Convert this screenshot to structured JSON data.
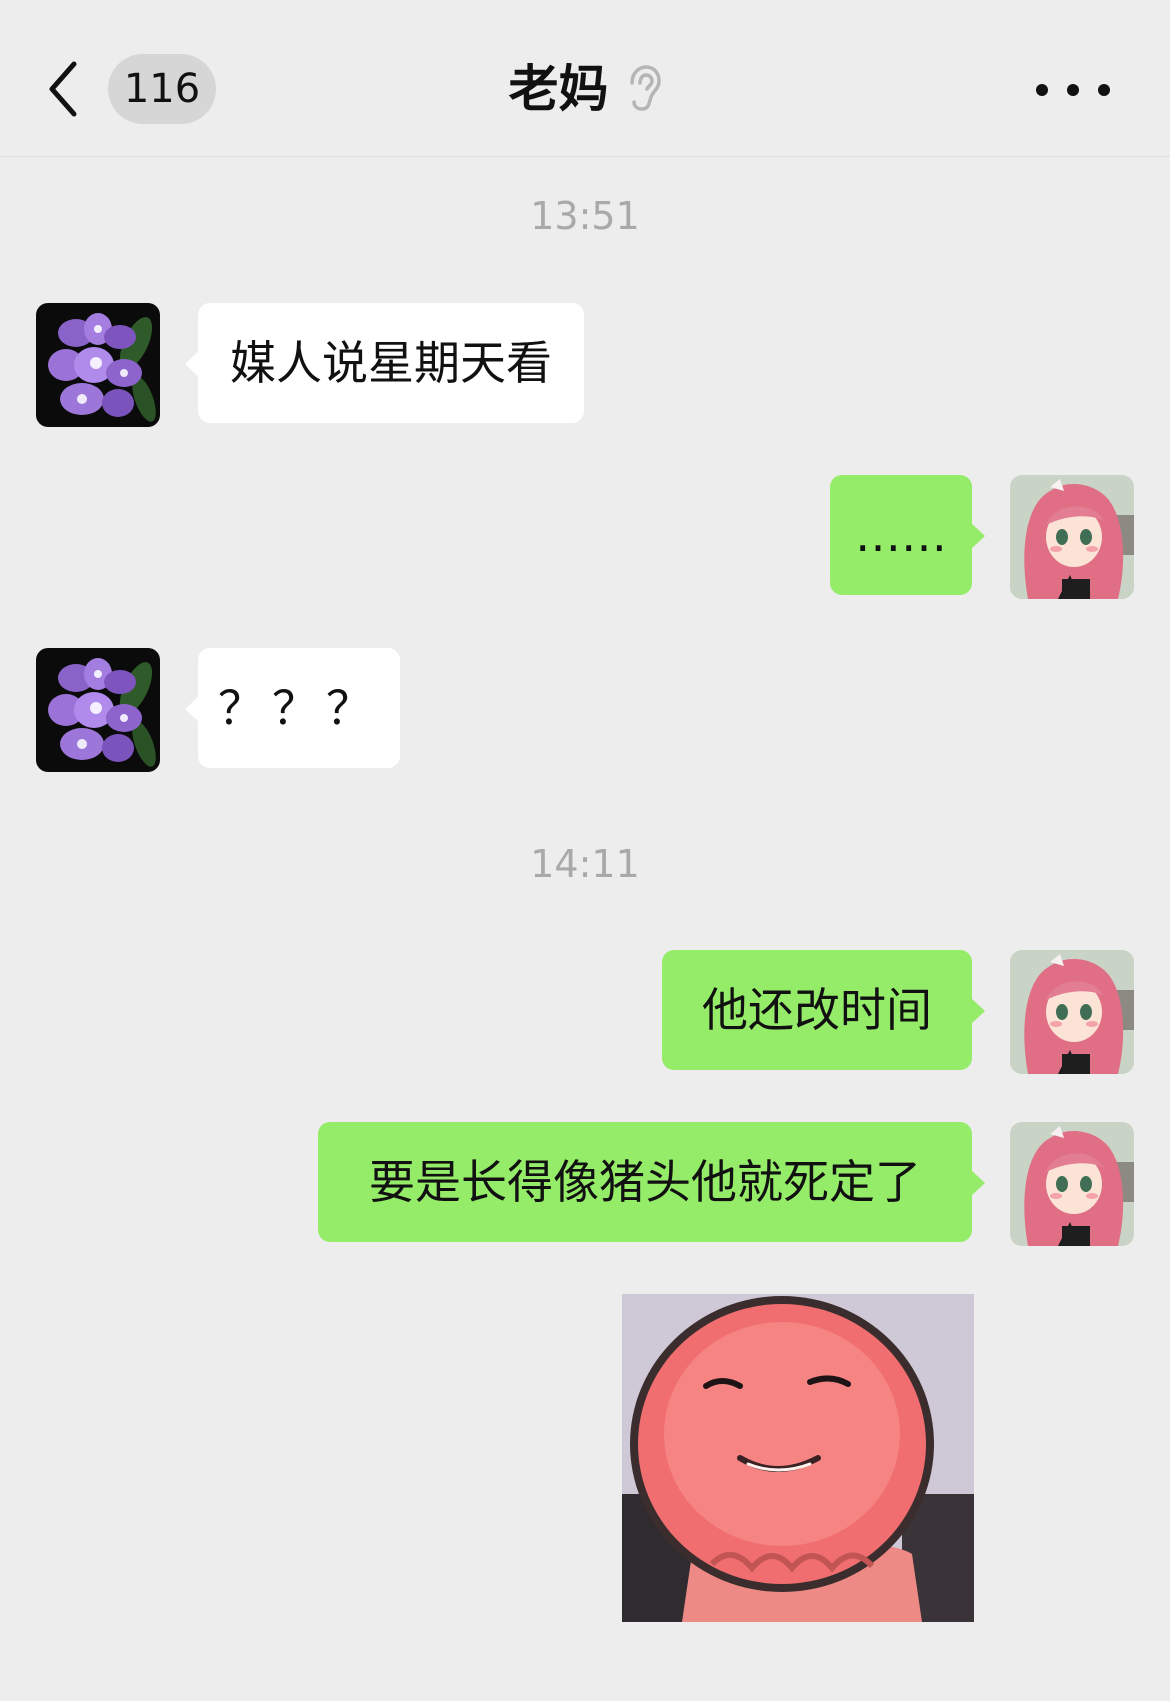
{
  "nav": {
    "back_label": "返回",
    "unread_count": "116",
    "title": "老妈",
    "title_status_icon": "ear-mute-icon",
    "more_icon": "more-dots-icon"
  },
  "colors": {
    "background": "#ededed",
    "incoming_bubble": "#ffffff",
    "outgoing_bubble": "#95ec69",
    "timestamp": "#a9a9a9"
  },
  "messages": [
    {
      "type": "time",
      "text": "13:51"
    },
    {
      "type": "text",
      "side": "left",
      "sender": "mom",
      "text": "媒人说星期天看"
    },
    {
      "type": "text",
      "side": "right",
      "sender": "me",
      "text": "……"
    },
    {
      "type": "text",
      "side": "left",
      "sender": "mom",
      "text": "？？？"
    },
    {
      "type": "time",
      "text": "14:11"
    },
    {
      "type": "text",
      "side": "right",
      "sender": "me",
      "text": "他还改时间"
    },
    {
      "type": "text",
      "side": "right",
      "sender": "me",
      "text": "要是长得像猪头他就死定了"
    },
    {
      "type": "sticker",
      "side": "right",
      "sender": "me",
      "icon": "smiling-pink-face-sticker"
    }
  ]
}
